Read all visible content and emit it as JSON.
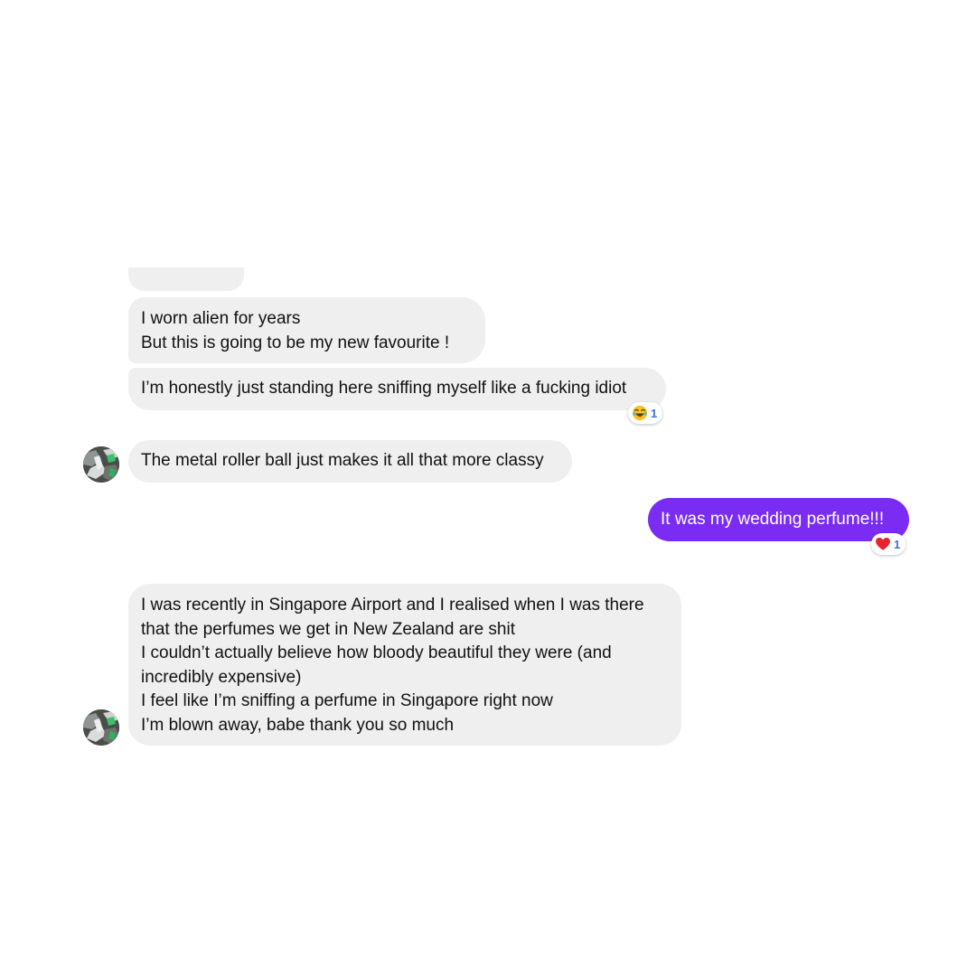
{
  "conversation": {
    "messages": [
      {
        "direction": "incoming",
        "lines": [
          "I worn alien for years",
          "But this is going to be my new favourite  !"
        ]
      },
      {
        "direction": "incoming",
        "lines": [
          "I’m honestly just standing here sniffing myself like a fucking idiot"
        ],
        "reaction": {
          "emoji": "laughing-face-icon",
          "count": "1"
        }
      },
      {
        "direction": "incoming",
        "lines": [
          "The metal roller ball just makes it all that more classy"
        ],
        "avatar": "contact-avatar"
      },
      {
        "direction": "outgoing",
        "lines": [
          "It was my wedding perfume!!!"
        ],
        "reaction": {
          "emoji": "red-heart-icon",
          "count": "1"
        }
      },
      {
        "direction": "incoming",
        "lines": [
          "I was recently in Singapore Airport and I realised when I was there",
          "that the perfumes we get in New Zealand are shit",
          "I couldn’t actually believe how bloody beautiful they were  (and",
          "incredibly expensive)",
          "I feel like I’m sniffing a perfume in Singapore right now",
          "I’m blown away, babe thank you so much"
        ],
        "avatar": "contact-avatar"
      }
    ]
  },
  "colors": {
    "incoming_bubble": "#efefef",
    "outgoing_bubble": "#7a2cf2",
    "reaction_count": "#3b6fd8",
    "background": "#ffffff"
  }
}
